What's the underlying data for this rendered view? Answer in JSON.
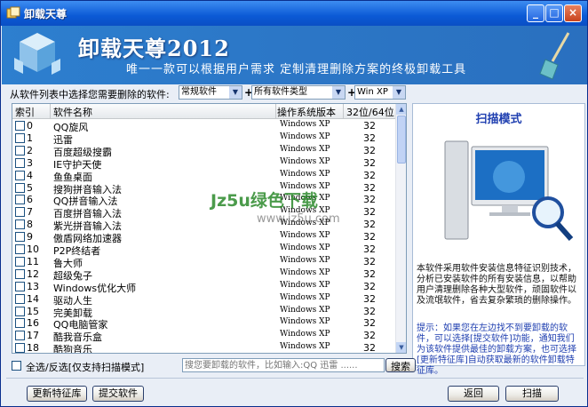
{
  "window": {
    "title": "卸载天尊"
  },
  "banner": {
    "brand": "卸载天尊2012",
    "slogan": "唯一一款可以根据用户需求 定制清理删除方案的终极卸载工具"
  },
  "filter": {
    "label": "从软件列表中选择您需要删除的软件:",
    "category": "常规软件",
    "type": "所有软件类型",
    "os": "Win XP"
  },
  "list": {
    "headers": [
      "索引",
      "软件名称",
      "操作系统版本",
      "32位/64位"
    ],
    "rows": [
      {
        "idx": "0",
        "name": "QQ旋风",
        "os": "Windows XP",
        "bit": "32"
      },
      {
        "idx": "1",
        "name": "迅雷",
        "os": "Windows XP",
        "bit": "32"
      },
      {
        "idx": "2",
        "name": "百度超级搜霸",
        "os": "Windows XP",
        "bit": "32"
      },
      {
        "idx": "3",
        "name": "IE守护天使",
        "os": "Windows XP",
        "bit": "32"
      },
      {
        "idx": "4",
        "name": "鱼鱼桌面",
        "os": "Windows XP",
        "bit": "32"
      },
      {
        "idx": "5",
        "name": "搜狗拼音输入法",
        "os": "Windows XP",
        "bit": "32"
      },
      {
        "idx": "6",
        "name": "QQ拼音输入法",
        "os": "Windows XP",
        "bit": "32"
      },
      {
        "idx": "7",
        "name": "百度拼音输入法",
        "os": "Windows XP",
        "bit": "32"
      },
      {
        "idx": "8",
        "name": "紫光拼音输入法",
        "os": "Windows XP",
        "bit": "32"
      },
      {
        "idx": "9",
        "name": "傲盾网络加速器",
        "os": "Windows XP",
        "bit": "32"
      },
      {
        "idx": "10",
        "name": "P2P终结者",
        "os": "Windows XP",
        "bit": "32"
      },
      {
        "idx": "11",
        "name": "鲁大师",
        "os": "Windows XP",
        "bit": "32"
      },
      {
        "idx": "12",
        "name": "超级兔子",
        "os": "Windows XP",
        "bit": "32"
      },
      {
        "idx": "13",
        "name": "Windows优化大师",
        "os": "Windows XP",
        "bit": "32"
      },
      {
        "idx": "14",
        "name": "驱动人生",
        "os": "Windows XP",
        "bit": "32"
      },
      {
        "idx": "15",
        "name": "完美卸载",
        "os": "Windows XP",
        "bit": "32"
      },
      {
        "idx": "16",
        "name": "QQ电脑管家",
        "os": "Windows XP",
        "bit": "32"
      },
      {
        "idx": "17",
        "name": "酷我音乐盒",
        "os": "Windows XP",
        "bit": "32"
      },
      {
        "idx": "18",
        "name": "酷狗音乐",
        "os": "Windows XP",
        "bit": "32"
      }
    ]
  },
  "right": {
    "mode": "扫描模式",
    "desc": "本软件采用软件安装信息特征识别技术，分析已安装软件的所有安装信息，以帮助用户清理删除各种大型软件，顽固软件以及流氓软件，省去复杂繁琐的删除操作。",
    "tip": "提示：如果您在左边找不到要卸载的软件，可以选择[提交软件]功能，通知我们为该软件提供最佳的卸载方案，也可选择[更新特征库]自动获取最新的软件卸载特征库。"
  },
  "bottom": {
    "select_all": "全选/反选[仅支持扫描模式]",
    "search_placeholder": "搜您要卸载的软件，比如输入:QQ 迅雷 ......",
    "search_btn": "搜索"
  },
  "footer": {
    "update_btn": "更新特征库",
    "submit_btn": "提交软件",
    "back_btn": "返回",
    "scan_btn": "扫描"
  },
  "watermark": {
    "line1": "Jz5u绿色下载",
    "line2": "www.jz5u.com"
  },
  "colors": {
    "titlebar": "#0b5ad6",
    "banner": "#2c78c8",
    "accent": "#1f3fb0"
  }
}
